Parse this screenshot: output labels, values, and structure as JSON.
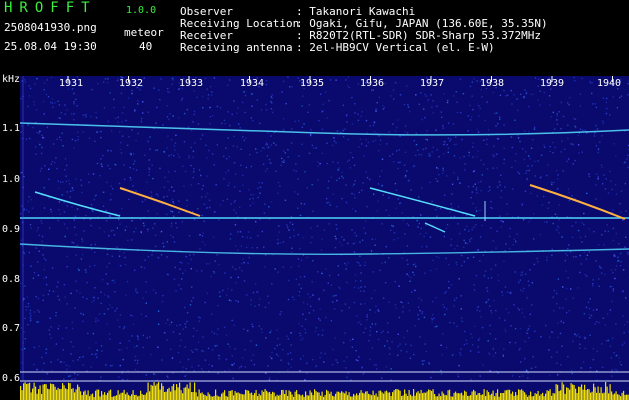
{
  "header": {
    "app_title": "HROFFT",
    "app_version": "1.0.0",
    "filename": "2508041930.png",
    "timestamp": "25.08.04 19:30",
    "meteor_label": "meteor",
    "meteor_count": "40",
    "info": [
      {
        "key": "Observer",
        "value": ": Takanori Kawachi"
      },
      {
        "key": "Receiving Location",
        "value": ": Ogaki, Gifu, JAPAN (136.60E, 35.35N)"
      },
      {
        "key": "Receiver",
        "value": ": R820T2(RTL-SDR) SDR-Sharp 53.372MHz"
      },
      {
        "key": "Receiving antenna",
        "value": ": 2el-HB9CV Vertical (el. E-W)"
      }
    ]
  },
  "spectrogram": {
    "y_unit": "kHz",
    "y_ticks": [
      "1.1",
      "1.0",
      "0.9",
      "0.8",
      "0.7",
      "0.6"
    ],
    "x_ticks": [
      "1931",
      "1932",
      "1933",
      "1934",
      "1935",
      "1936",
      "1937",
      "1938",
      "1939",
      "1940"
    ],
    "background_color": "#0a0a6e",
    "trace_color": "#55e0ff",
    "meteor_color": "#ffb040",
    "bottom_bar_color": "#f0e000"
  }
}
